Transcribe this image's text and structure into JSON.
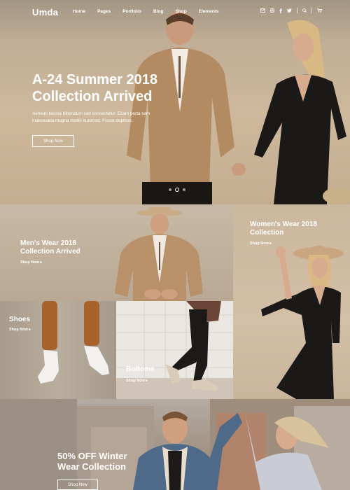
{
  "header": {
    "logo": "Umda",
    "nav": [
      "Home",
      "Pages",
      "Portfolio",
      "Blog",
      "Shop",
      "Elements"
    ],
    "icons": [
      "mail-icon",
      "instagram-icon",
      "facebook-icon",
      "twitter-icon",
      "search-icon",
      "cart-icon"
    ]
  },
  "hero": {
    "title_line1": "A-24 Summer 2018",
    "title_line2": "Collection Arrived",
    "subtitle_line1": "Aenean lacinia bibendum sed consectetur. Etiam porta sem",
    "subtitle_line2": "malesuada magna mollis euismod. Fusce dapibus.",
    "button": "Shop Now",
    "slides": 3,
    "active_slide": 2
  },
  "tiles": {
    "mens": {
      "title_line1": "Men's Wear 2018",
      "title_line2": "Collection Arrived",
      "link": "Shop Now ▸"
    },
    "womens": {
      "title_line1": "Women's Wear 2018",
      "title_line2": "Collection",
      "link": "Shop Now ▸"
    },
    "shoes": {
      "title": "Shoes",
      "link": "Shop Now ▸"
    },
    "bottoms": {
      "title": "Bottoms",
      "link": "Shop Now ▸"
    },
    "sale": {
      "title_line1": "50% OFF Winter",
      "title_line2": "Wear Collection",
      "button": "Shop Now"
    }
  }
}
